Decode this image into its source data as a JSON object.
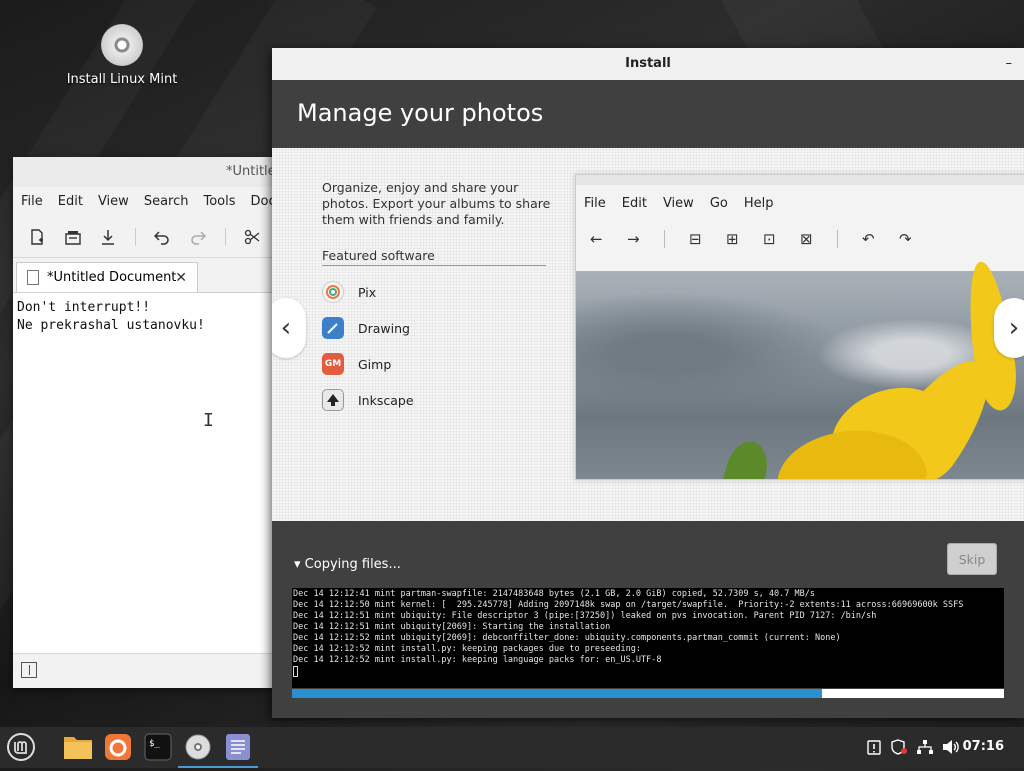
{
  "desktop": {
    "icon_label": "Install Linux Mint"
  },
  "editor": {
    "title": "*Untitled Document - Text Editor",
    "menu": [
      "File",
      "Edit",
      "View",
      "Search",
      "Tools",
      "Documents"
    ],
    "tab_label": "*Untitled Document",
    "line1": "Don't interrupt!!",
    "line2": "Ne prekrashal ustanovku!"
  },
  "installer": {
    "title": "Install",
    "heading": "Manage your photos",
    "description": "Organize, enjoy and share your photos. Export your albums to share them with friends and family.",
    "featured_title": "Featured software",
    "apps": [
      {
        "name": "Pix",
        "color": "#f5f5f5"
      },
      {
        "name": "Drawing",
        "color": "#3d7fc9"
      },
      {
        "name": "Gimp",
        "color": "#e25d40"
      },
      {
        "name": "Inkscape",
        "color": "#5a5a5a"
      }
    ],
    "pix_menu": [
      "File",
      "Edit",
      "View",
      "Go",
      "Help"
    ],
    "status": "Copying files...",
    "skip_label": "Skip",
    "progress": 0.745,
    "log": [
      "Dec 14 12:12:41 mint partman-swapfile: 2147483648 bytes (2.1 GB, 2.0 GiB) copied, 52.7309 s, 40.7 MB/s",
      "Dec 14 12:12:50 mint kernel: [  295.245778] Adding 2097148k swap on /target/swapfile.  Priority:-2 extents:11 across:66969600k SSFS",
      "Dec 14 12:12:51 mint ubiquity: File descriptor 3 (pipe:[37250]) leaked on pvs invocation. Parent PID 7127: /bin/sh",
      "Dec 14 12:12:51 mint ubiquity[2069]: Starting the installation",
      "Dec 14 12:12:52 mint ubiquity[2069]: debconffilter_done: ubiquity.components.partman_commit (current: None)",
      "Dec 14 12:12:52 mint install.py: keeping packages due to preseeding:",
      "Dec 14 12:12:52 mint install.py: keeping language packs for: en_US.UTF-8"
    ]
  },
  "taskbar": {
    "clock": "07:16",
    "accent": "#4a9ad4"
  }
}
